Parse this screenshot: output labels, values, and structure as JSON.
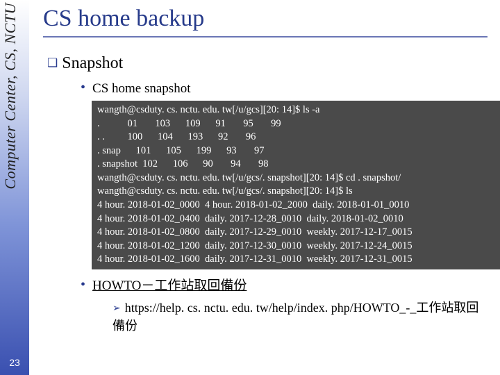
{
  "side": {
    "org": "Computer Center, CS, NCTU"
  },
  "page_number": "23",
  "title": "CS home backup",
  "bullets": {
    "lvl1_marker": "❑",
    "lvl2_marker": "•",
    "lvl3_marker": "➢",
    "snapshot_heading": "Snapshot",
    "snapshot_sub": "CS home snapshot",
    "howto_label": "HOWTO－工作站取回備份",
    "howto_url": "https://help. cs. nctu. edu. tw/help/index. php/HOWTO_-_工作站取回備份"
  },
  "terminal": {
    "lines": [
      "wangth@csduty. cs. nctu. edu. tw[/u/gcs][20: 14]$ ls -a",
      ".           01       103      109      91       95       99",
      ". .         100      104      193      92       96",
      ". snap      101      105      199      93       97",
      ". snapshot  102      106      90       94       98",
      "wangth@csduty. cs. nctu. edu. tw[/u/gcs/. snapshot][20: 14]$ cd . snapshot/",
      "wangth@csduty. cs. nctu. edu. tw[/u/gcs/. snapshot][20: 14]$ ls",
      "4 hour. 2018-01-02_0000  4 hour. 2018-01-02_2000  daily. 2018-01-01_0010",
      "4 hour. 2018-01-02_0400  daily. 2017-12-28_0010  daily. 2018-01-02_0010",
      "4 hour. 2018-01-02_0800  daily. 2017-12-29_0010  weekly. 2017-12-17_0015",
      "4 hour. 2018-01-02_1200  daily. 2017-12-30_0010  weekly. 2017-12-24_0015",
      "4 hour. 2018-01-02_1600  daily. 2017-12-31_0010  weekly. 2017-12-31_0015"
    ]
  }
}
